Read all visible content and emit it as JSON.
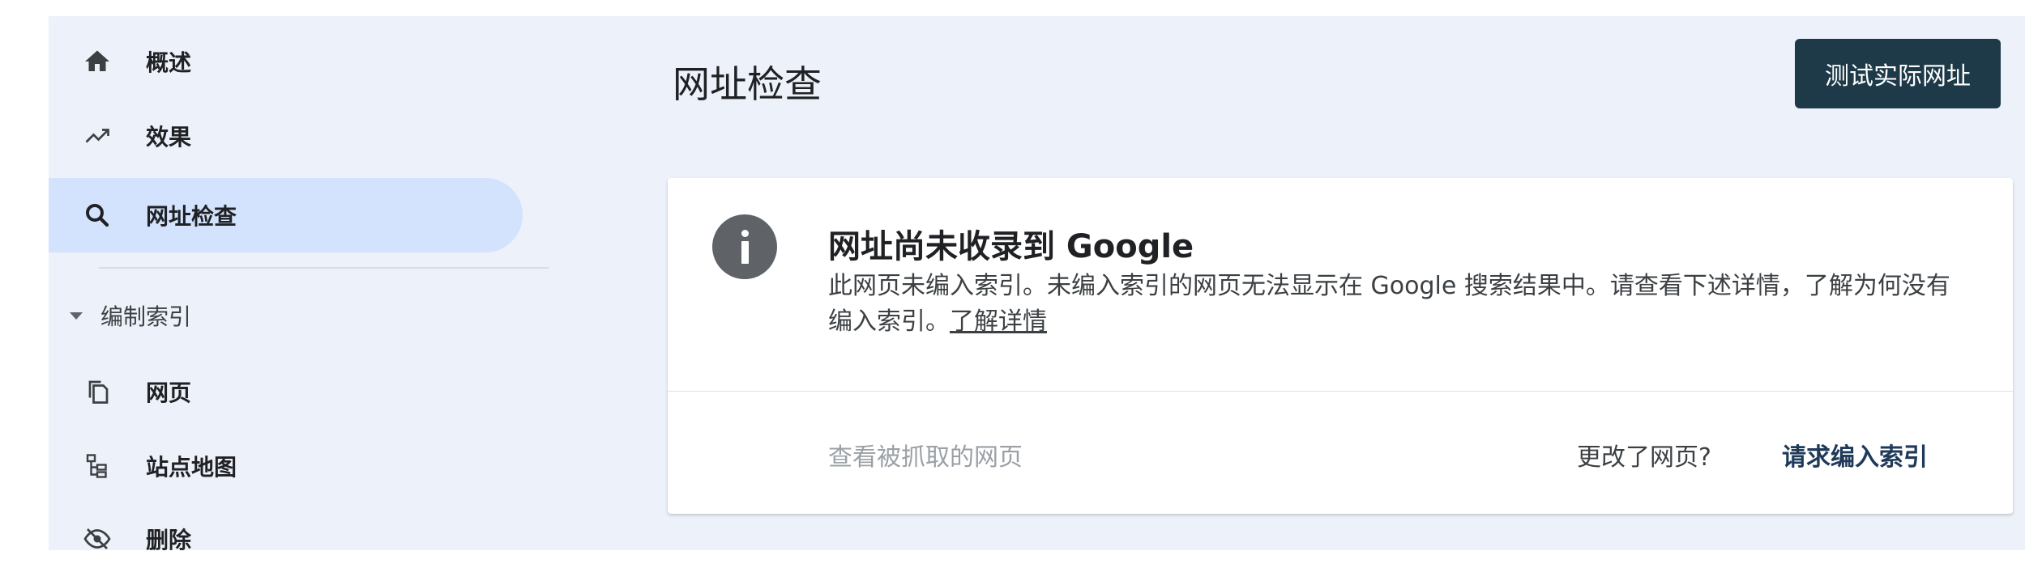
{
  "sidebar": {
    "items": [
      {
        "label": "概述",
        "icon": "home-icon"
      },
      {
        "label": "效果",
        "icon": "trending-up-icon"
      },
      {
        "label": "网址检查",
        "icon": "search-icon",
        "active": true
      }
    ],
    "section": {
      "label": "编制索引",
      "icon": "caret-down-icon"
    },
    "sub_items": [
      {
        "label": "网页",
        "icon": "pages-icon"
      },
      {
        "label": "站点地图",
        "icon": "sitemap-icon"
      },
      {
        "label": "删除",
        "icon": "removals-icon"
      }
    ]
  },
  "header": {
    "title": "网址检查",
    "test_live_button": "测试实际网址"
  },
  "card": {
    "icon": "info-icon",
    "title": "网址尚未收录到 Google",
    "description": "此网页未编入索引。未编入索引的网页无法显示在 Google 搜索结果中。请查看下述详情，了解为何没有编入索引。",
    "learn_more": "了解详情",
    "view_crawled": "查看被抓取的网页",
    "page_changed": "更改了网页?",
    "request_indexing": "请求编入索引"
  },
  "colors": {
    "background": "#edf1f9",
    "active_nav": "#d3e3fd",
    "button": "#1e3a48",
    "link": "#1f3a58"
  }
}
